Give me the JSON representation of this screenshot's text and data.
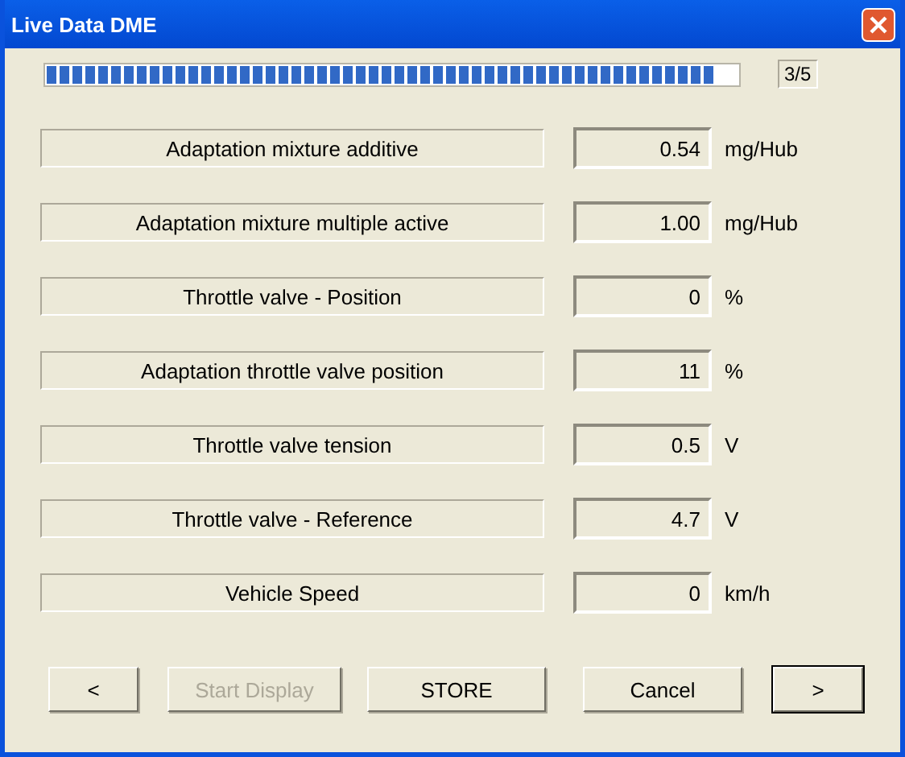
{
  "window": {
    "title": "Live Data DME"
  },
  "progress": {
    "level": 0.97,
    "counter": "3/5"
  },
  "rows": [
    {
      "label": "Adaptation mixture additive",
      "value": "0.54",
      "unit": "mg/Hub"
    },
    {
      "label": "Adaptation mixture multiple active",
      "value": "1.00",
      "unit": "mg/Hub"
    },
    {
      "label": "Throttle valve - Position",
      "value": "0",
      "unit": "%"
    },
    {
      "label": "Adaptation throttle valve position",
      "value": "11",
      "unit": "%"
    },
    {
      "label": "Throttle valve tension",
      "value": "0.5",
      "unit": "V"
    },
    {
      "label": "Throttle valve - Reference",
      "value": "4.7",
      "unit": "V"
    },
    {
      "label": "Vehicle Speed",
      "value": "0",
      "unit": "km/h"
    }
  ],
  "buttons": [
    {
      "label": "<",
      "disabled": false,
      "default": false
    },
    {
      "label": "Start Display",
      "disabled": true,
      "default": false
    },
    {
      "label": "STORE",
      "disabled": false,
      "default": false
    },
    {
      "label": "Cancel",
      "disabled": false,
      "default": false
    },
    {
      "label": ">",
      "disabled": false,
      "default": true
    }
  ]
}
